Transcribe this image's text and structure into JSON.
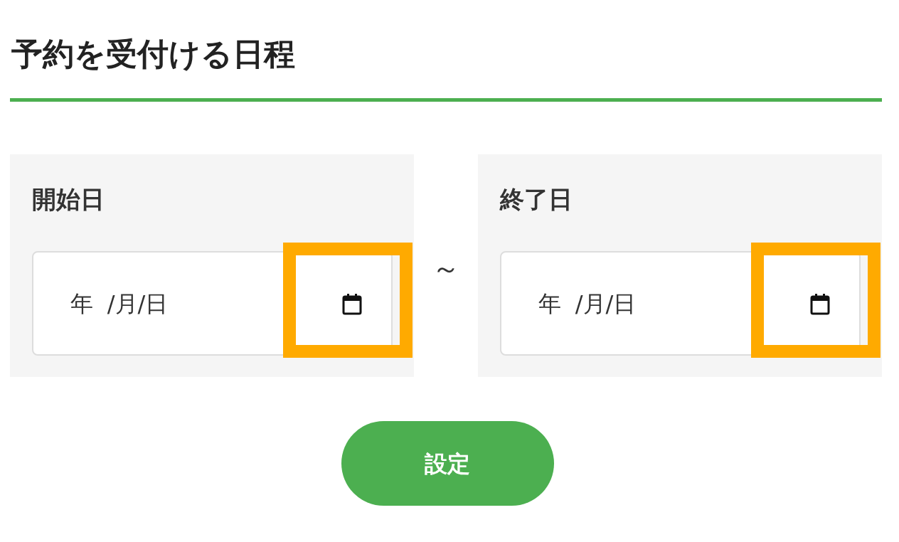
{
  "title": "予約を受付ける日程",
  "date_fields": [
    {
      "label": "開始日",
      "value": "年 /月/日",
      "highlighted": true
    },
    {
      "label": "終了日",
      "value": "年 /月/日",
      "highlighted": true
    }
  ],
  "separator": "～",
  "submit_button": "設定"
}
